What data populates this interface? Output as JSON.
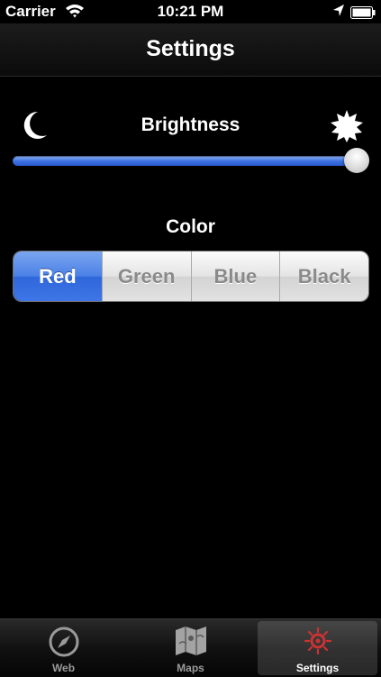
{
  "status_bar": {
    "carrier": "Carrier",
    "time": "10:21 PM",
    "wifi_icon": "wifi-icon",
    "location_icon": "location-arrow-icon",
    "battery_icon": "battery-icon"
  },
  "nav": {
    "title": "Settings"
  },
  "brightness": {
    "label": "Brightness",
    "value": 1.0,
    "min_icon": "moon-icon",
    "max_icon": "sun-icon",
    "track_color": "#3a6fe2"
  },
  "color": {
    "label": "Color",
    "options": [
      "Red",
      "Green",
      "Blue",
      "Black"
    ],
    "selected": "Red",
    "selected_color": "#3e76e6"
  },
  "tab_bar": {
    "tabs": [
      {
        "label": "Web",
        "icon": "compass-icon"
      },
      {
        "label": "Maps",
        "icon": "map-icon"
      },
      {
        "label": "Settings",
        "icon": "gear-icon"
      }
    ],
    "selected": "Settings"
  }
}
